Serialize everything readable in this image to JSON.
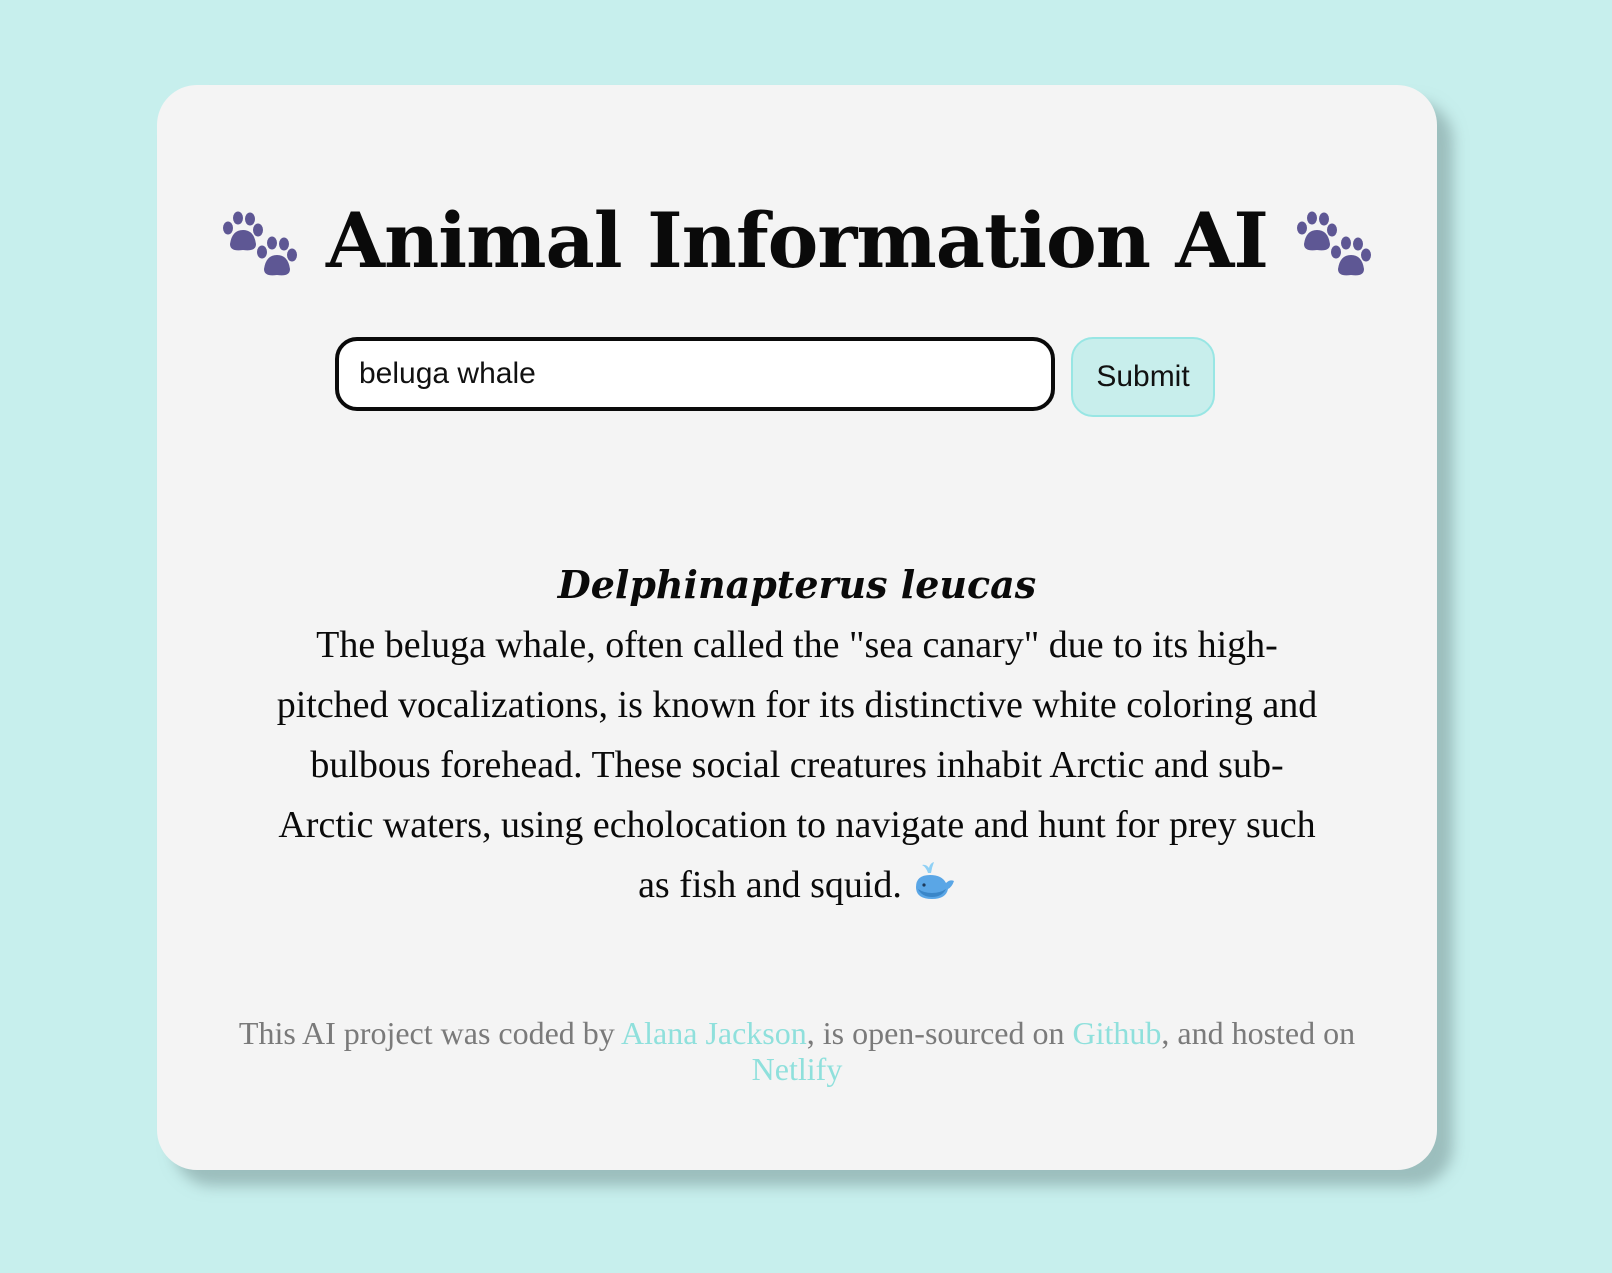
{
  "page": {
    "title": "Animal Information AI",
    "icons": {
      "left": "paw-prints-icon",
      "right": "paw-prints-icon"
    }
  },
  "search": {
    "value": "beluga whale",
    "submit_label": "Submit"
  },
  "result": {
    "scientific_name": "Delphinapterus leucas",
    "description": "The beluga whale, often called the \"sea canary\" due to its high-pitched vocalizations, is known for its distinctive white coloring and bulbous forehead. These social creatures inhabit Arctic and sub-Arctic waters, using echolocation to navigate and hunt for prey such as fish and squid.",
    "emoji": "spouting-whale-icon"
  },
  "footer": {
    "text_1": "This AI project was coded by ",
    "author_link": "Alana Jackson",
    "text_2": ", is open-sourced on ",
    "github_link": "Github",
    "text_3": ", and hosted on ",
    "netlify_link": "Netlify"
  },
  "colors": {
    "background": "#c7efed",
    "card": "#f4f4f4",
    "paw": "#5e5794",
    "accent_link": "#8fe0dc",
    "button_bg": "#c8eeec"
  }
}
